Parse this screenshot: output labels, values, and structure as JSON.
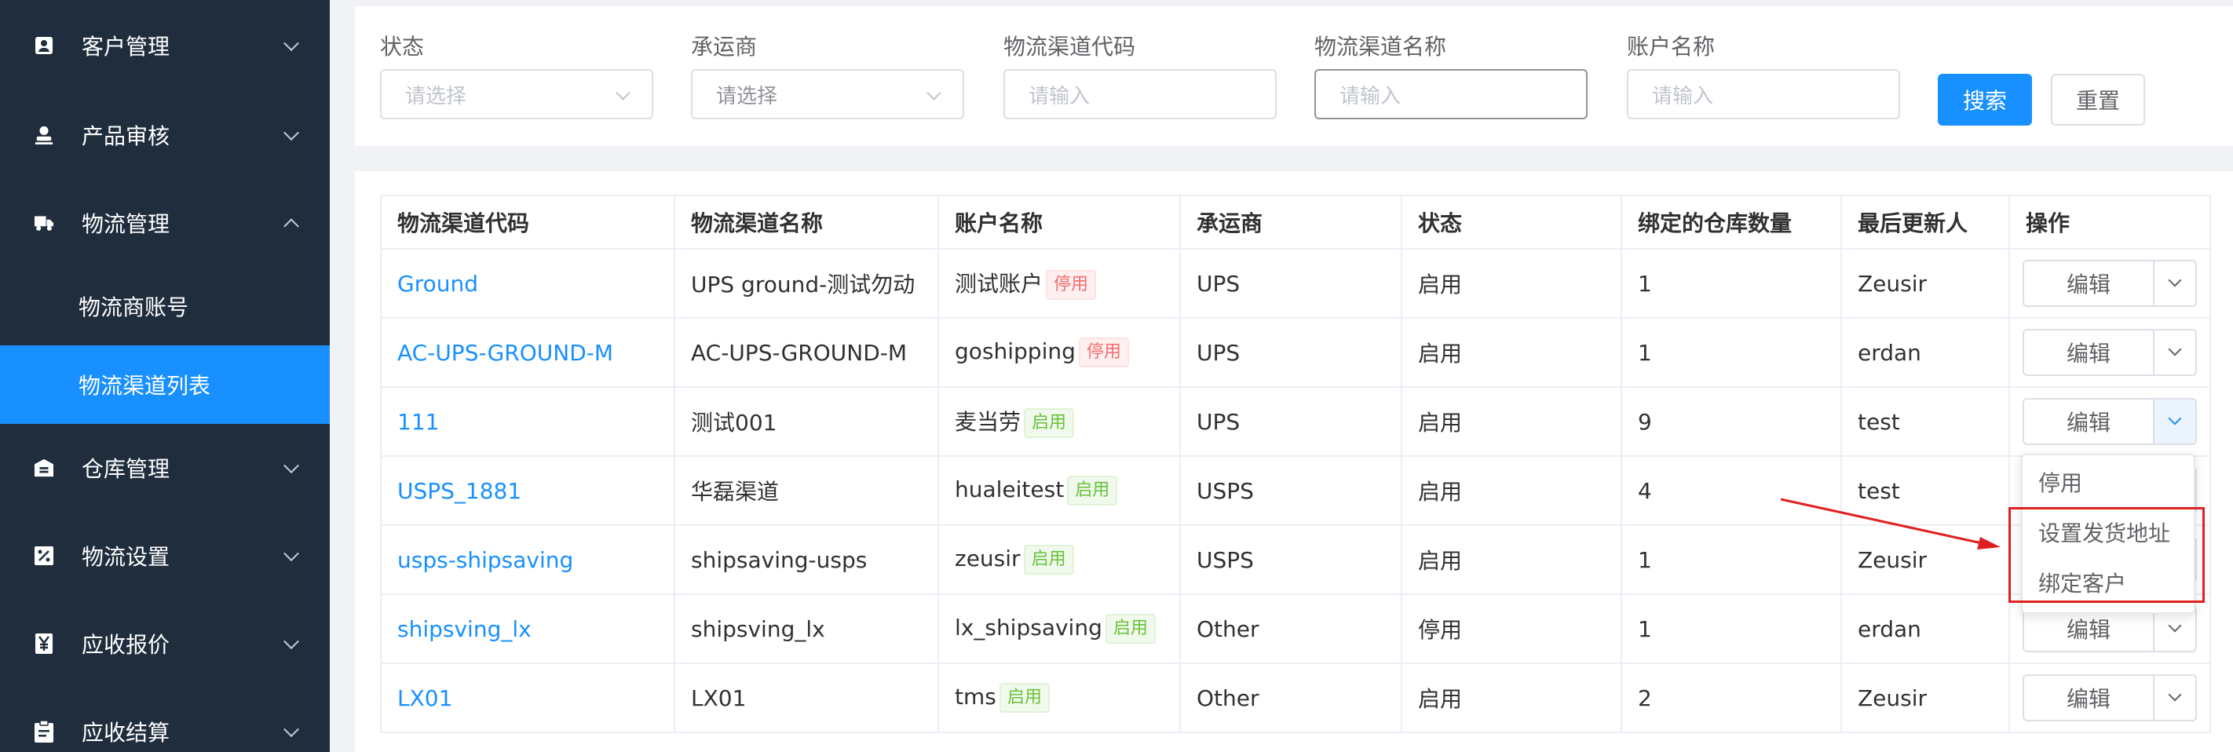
{
  "sidebar": {
    "menu": [
      {
        "label": "客户管理",
        "icon": "contact-card-icon",
        "expanded": false
      },
      {
        "label": "产品审核",
        "icon": "user-stamp-icon",
        "expanded": false
      },
      {
        "label": "物流管理",
        "icon": "truck-icon",
        "expanded": true,
        "children": [
          {
            "label": "物流商账号",
            "active": false
          },
          {
            "label": "物流渠道列表",
            "active": true
          }
        ]
      },
      {
        "label": "仓库管理",
        "icon": "warehouse-icon",
        "expanded": false
      },
      {
        "label": "物流设置",
        "icon": "percent-icon",
        "expanded": false
      },
      {
        "label": "应收报价",
        "icon": "yen-icon",
        "expanded": false
      },
      {
        "label": "应收结算",
        "icon": "clipboard-icon",
        "expanded": false
      }
    ]
  },
  "filters": {
    "status": {
      "label": "状态",
      "placeholder": "请选择"
    },
    "carrier": {
      "label": "承运商",
      "placeholder": "请选择"
    },
    "channel_code": {
      "label": "物流渠道代码",
      "placeholder": "请输入"
    },
    "channel_name": {
      "label": "物流渠道名称",
      "placeholder": "请输入"
    },
    "account_name": {
      "label": "账户名称",
      "placeholder": "请输入"
    },
    "search_label": "搜索",
    "reset_label": "重置"
  },
  "table": {
    "headers": [
      "物流渠道代码",
      "物流渠道名称",
      "账户名称",
      "承运商",
      "状态",
      "绑定的仓库数量",
      "最后更新人",
      "操作"
    ],
    "rows": [
      {
        "code": "Ground",
        "name": "UPS ground-测试勿动",
        "account": "测试账户",
        "tag": "停用",
        "tag_type": "red",
        "carrier": "UPS",
        "status": "启用",
        "count": "1",
        "updater": "Zeusir"
      },
      {
        "code": "AC-UPS-GROUND-M",
        "name": "AC-UPS-GROUND-M",
        "account": "goshipping",
        "tag": "停用",
        "tag_type": "red",
        "carrier": "UPS",
        "status": "启用",
        "count": "1",
        "updater": "erdan"
      },
      {
        "code": "111",
        "name": "测试001",
        "account": "麦当劳",
        "tag": "启用",
        "tag_type": "green",
        "carrier": "UPS",
        "status": "启用",
        "count": "9",
        "updater": "test"
      },
      {
        "code": "USPS_1881",
        "name": "华磊渠道",
        "account": "hualeitest",
        "tag": "启用",
        "tag_type": "green",
        "carrier": "USPS",
        "status": "启用",
        "count": "4",
        "updater": "test"
      },
      {
        "code": "usps-shipsaving",
        "name": "shipsaving-usps",
        "account": "zeusir",
        "tag": "启用",
        "tag_type": "green",
        "carrier": "USPS",
        "status": "启用",
        "count": "1",
        "updater": "Zeusir"
      },
      {
        "code": "shipsving_lx",
        "name": "shipsving_lx",
        "account": "lx_shipsaving",
        "tag": "启用",
        "tag_type": "green",
        "carrier": "Other",
        "status": "停用",
        "count": "1",
        "updater": "erdan"
      },
      {
        "code": "LX01",
        "name": "LX01",
        "account": "tms",
        "tag": "启用",
        "tag_type": "green",
        "carrier": "Other",
        "status": "启用",
        "count": "2",
        "updater": "Zeusir"
      }
    ],
    "edit_label": "编辑"
  },
  "dropdown": {
    "items": [
      "停用",
      "设置发货地址",
      "绑定客户"
    ]
  },
  "colors": {
    "sidebar_bg": "#1f2d3d",
    "primary": "#1890ff",
    "annotation": "#e02020"
  }
}
